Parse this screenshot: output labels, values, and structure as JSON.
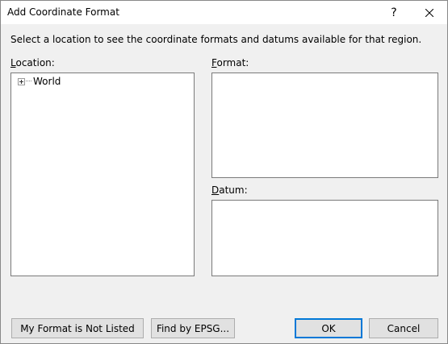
{
  "window": {
    "title": "Add Coordinate Format",
    "help_label": "?"
  },
  "instructions": "Select a location to see the coordinate formats and datums available for that region.",
  "location": {
    "label_accel": "L",
    "label_rest": "ocation:",
    "tree": [
      {
        "label": "World",
        "expanded": false
      }
    ]
  },
  "format": {
    "label_accel": "F",
    "label_rest": "ormat:",
    "items": []
  },
  "datum": {
    "label_accel": "D",
    "label_rest": "atum:",
    "items": []
  },
  "buttons": {
    "not_listed": "My Format is Not Listed",
    "find_epsg": "Find by EPSG...",
    "ok": "OK",
    "cancel": "Cancel"
  },
  "colors": {
    "dialog_bg": "#f0f0f0",
    "titlebar_bg": "#ffffff",
    "default_button_border": "#0078d7"
  }
}
